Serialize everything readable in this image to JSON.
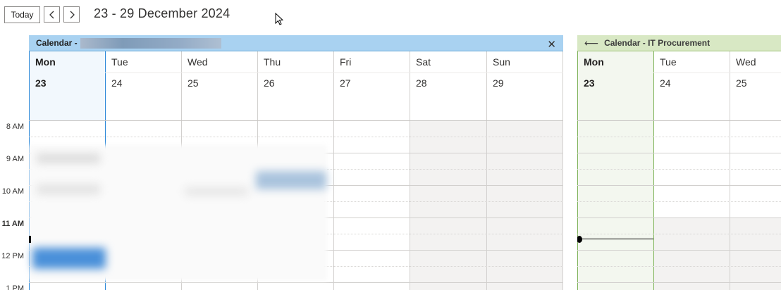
{
  "toolbar": {
    "today_label": "Today",
    "prev_icon": "chevron-left-icon",
    "next_icon": "chevron-right-icon",
    "range_title": "23 - 29 December 2024"
  },
  "time_labels": [
    "8 AM",
    "9 AM",
    "10 AM",
    "11 AM",
    "12 PM",
    "1 PM"
  ],
  "calendars": [
    {
      "title_prefix": "Calendar -",
      "accent": "#a9d2f1",
      "days": [
        {
          "name": "Mon",
          "num": "23",
          "today": true
        },
        {
          "name": "Tue",
          "num": "24"
        },
        {
          "name": "Wed",
          "num": "25"
        },
        {
          "name": "Thu",
          "num": "26"
        },
        {
          "name": "Fri",
          "num": "27"
        },
        {
          "name": "Sat",
          "num": "28"
        },
        {
          "name": "Sun",
          "num": "29"
        }
      ]
    },
    {
      "title": "Calendar - IT Procurement",
      "accent": "#d8e8c4",
      "days": [
        {
          "name": "Mon",
          "num": "23",
          "today": true
        },
        {
          "name": "Tue",
          "num": "24"
        },
        {
          "name": "Wed",
          "num": "25"
        }
      ]
    }
  ],
  "colors": {
    "today_col_blue": "#f2f8fd",
    "today_col_green": "#f3f7ef",
    "weekend_shade": "#f3f2f1",
    "event_blue": "#4a90d9"
  }
}
